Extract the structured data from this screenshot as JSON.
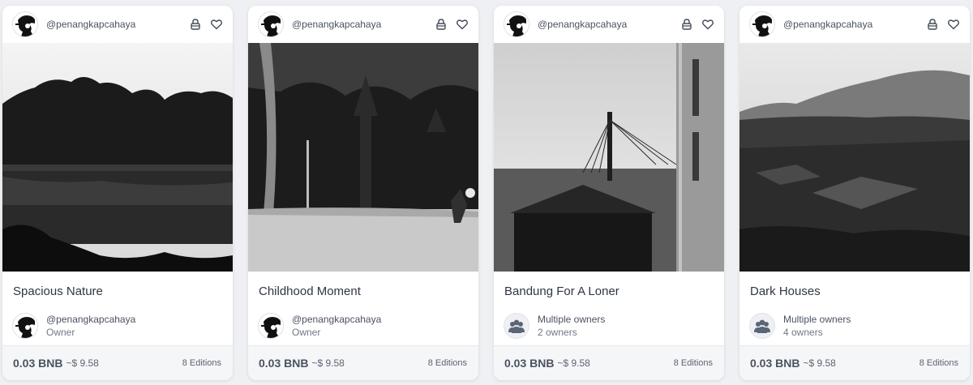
{
  "cards": [
    {
      "handle": "@penangkapcahaya",
      "title": "Spacious Nature",
      "owner_name": "@penangkapcahaya",
      "owner_role": "Owner",
      "price": "0.03 BNB",
      "usd": "~$ 9.58",
      "editions": "8 Editions"
    },
    {
      "handle": "@penangkapcahaya",
      "title": "Childhood Moment",
      "owner_name": "@penangkapcahaya",
      "owner_role": "Owner",
      "price": "0.03 BNB",
      "usd": "~$ 9.58",
      "editions": "8 Editions"
    },
    {
      "handle": "@penangkapcahaya",
      "title": "Bandung For A Loner",
      "owner_name": "Multiple owners",
      "owner_role": "2 owners",
      "price": "0.03 BNB",
      "usd": "~$ 9.58",
      "editions": "8 Editions"
    },
    {
      "handle": "@penangkapcahaya",
      "title": "Dark Houses",
      "owner_name": "Multiple owners",
      "owner_role": "4 owners",
      "price": "0.03 BNB",
      "usd": "~$ 9.58",
      "editions": "8 Editions"
    }
  ],
  "colors": {
    "background": "#eef0f3",
    "card": "#ffffff",
    "footer": "#f5f6f8",
    "multi_owner_icon": "#5a6577"
  },
  "icons": {
    "lock": "lock-icon",
    "heart": "heart-icon",
    "multiple_owners": "users-icon"
  }
}
